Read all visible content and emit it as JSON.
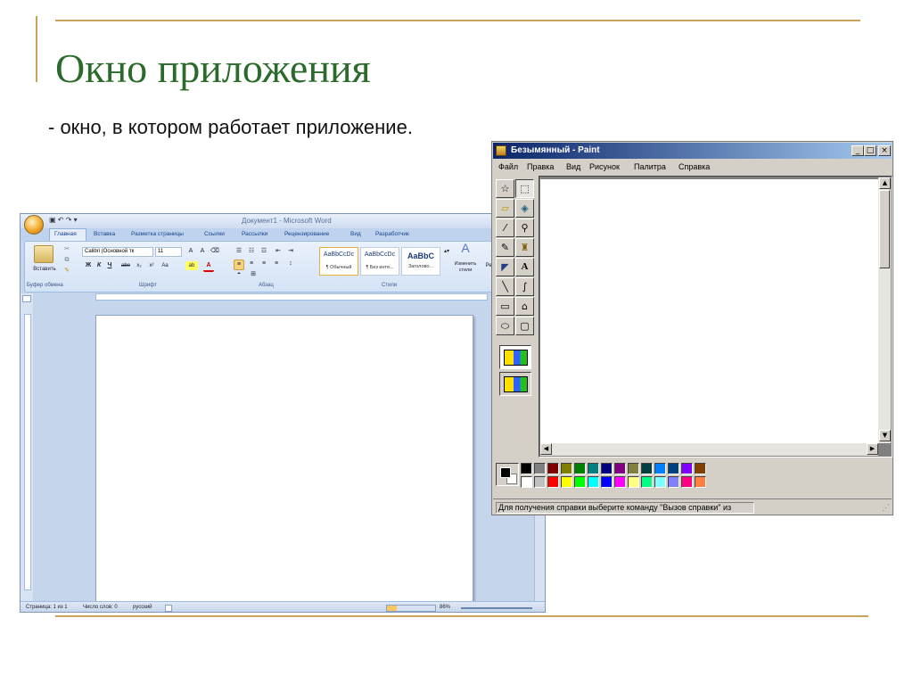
{
  "slide": {
    "title": "Окно приложения",
    "subtitle": "- окно, в котором работает приложение."
  },
  "word": {
    "title": "Документ1 - Microsoft Word",
    "qat": "▣ ↶ ↷ ▾",
    "tabs": [
      "Главная",
      "Вставка",
      "Разметка страницы",
      "Ссылки",
      "Рассылки",
      "Рецензирование",
      "Вид",
      "Разработчик"
    ],
    "ribbon": {
      "paste_label": "Вставить",
      "font_name": "Calibri (Основной тк",
      "font_size": "11",
      "format_buttons": [
        "Ж",
        "К",
        "Ч",
        "abe",
        "x₂",
        "x²",
        "Aa",
        "ab",
        "A"
      ],
      "styles": [
        {
          "sample": "AaBbCcDc",
          "name": "¶ Обычный"
        },
        {
          "sample": "AaBbCcDc",
          "name": "¶ Без инте..."
        },
        {
          "sample": "AaBbC",
          "name": "Заголово..."
        }
      ],
      "change_styles_label": "Изменить стили",
      "editing_label": "Ре",
      "group_labels": [
        "Буфер обмена",
        "Шрифт",
        "Абзац",
        "Стили"
      ]
    },
    "status": {
      "page": "Страница: 1 из 1",
      "words": "Число слов: 0",
      "language": "русский",
      "zoom": "86%"
    }
  },
  "paint": {
    "title": "Безымянный - Paint",
    "menu": [
      "Файл",
      "Правка",
      "Вид",
      "Рисунок",
      "Палитра",
      "Справка"
    ],
    "caption_buttons": [
      "_",
      "□",
      "×"
    ],
    "tools": [
      {
        "name": "free-select",
        "glyph": "☆"
      },
      {
        "name": "select",
        "glyph": "⬚"
      },
      {
        "name": "eraser",
        "glyph": "▱"
      },
      {
        "name": "fill",
        "glyph": "◈"
      },
      {
        "name": "color-picker",
        "glyph": "⁄"
      },
      {
        "name": "magnifier",
        "glyph": "⚲"
      },
      {
        "name": "pencil",
        "glyph": "✎"
      },
      {
        "name": "brush",
        "glyph": "♜"
      },
      {
        "name": "airbrush",
        "glyph": "◤"
      },
      {
        "name": "text",
        "glyph": "A"
      },
      {
        "name": "line",
        "glyph": "╲"
      },
      {
        "name": "curve",
        "glyph": "∫"
      },
      {
        "name": "rectangle",
        "glyph": "▭"
      },
      {
        "name": "polygon",
        "glyph": "⌂"
      },
      {
        "name": "ellipse",
        "glyph": "⬭"
      },
      {
        "name": "rounded-rectangle",
        "glyph": "▢"
      }
    ],
    "palette_top": [
      "#000000",
      "#808080",
      "#800000",
      "#808000",
      "#008000",
      "#008080",
      "#000080",
      "#800080",
      "#808040",
      "#004040",
      "#0080ff",
      "#004080",
      "#8000ff",
      "#804000"
    ],
    "palette_bottom": [
      "#ffffff",
      "#c0c0c0",
      "#ff0000",
      "#ffff00",
      "#00ff00",
      "#00ffff",
      "#0000ff",
      "#ff00ff",
      "#ffff80",
      "#00ff80",
      "#80ffff",
      "#8080ff",
      "#ff0080",
      "#ff8040"
    ],
    "foreground": "#000000",
    "background": "#ffffff",
    "status_text": "Для получения справки выберите команду \"Вызов справки\" из"
  }
}
